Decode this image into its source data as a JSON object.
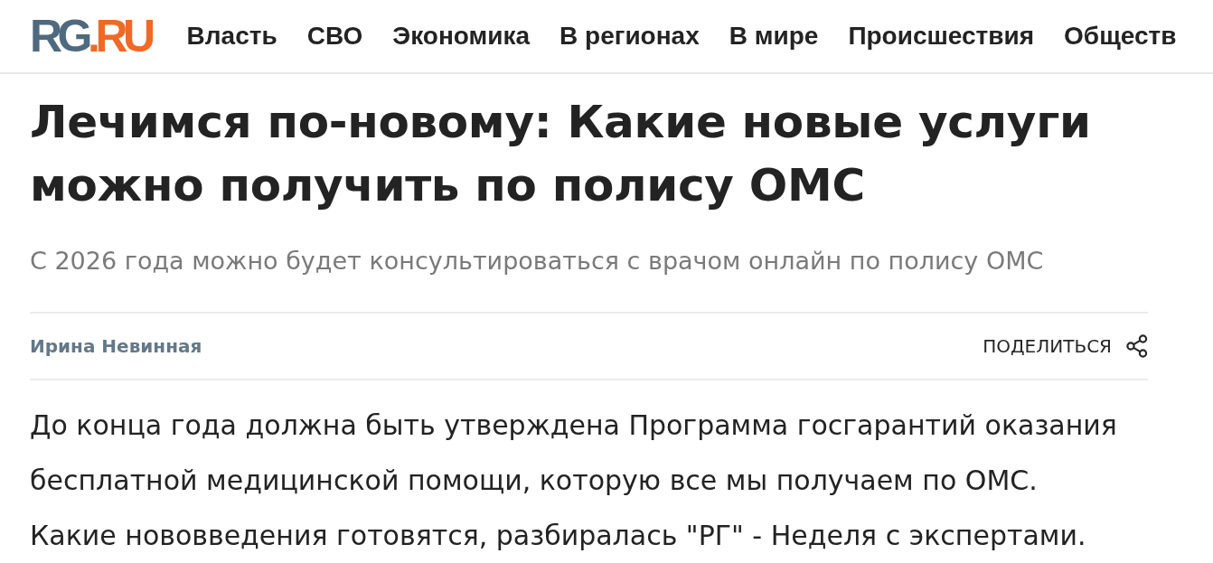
{
  "header": {
    "logo": {
      "part_1": "RG",
      "part_2": ".RU"
    },
    "nav": [
      "Власть",
      "СВО",
      "Экономика",
      "В регионах",
      "В мире",
      "Происшествия",
      "Обществ"
    ]
  },
  "article": {
    "title": "Лечимся по-новому: Какие новые услуги можно получить по полису ОМС",
    "subtitle": "С 2026 года можно будет консультироваться с врачом онлайн по полису ОМС",
    "author": "Ирина Невинная",
    "share": {
      "label": "ПОДЕЛИТЬСЯ"
    },
    "body": "До конца года должна быть утверждена Программа госгарантий оказания бесплатной медицинской помощи, которую все мы получаем по ОМС. Какие нововведения готовятся, разбиралась \"РГ\" - Неделя с экспертами."
  }
}
